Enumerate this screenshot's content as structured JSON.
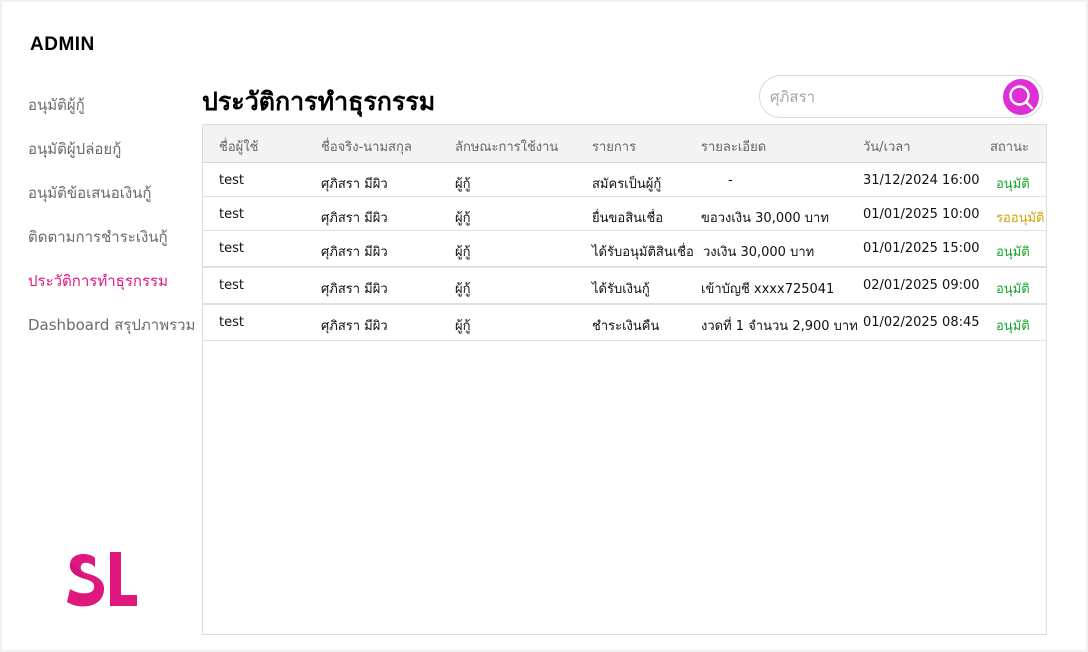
{
  "app": {
    "brand": "ADMIN"
  },
  "sidebar": {
    "items": [
      {
        "label": "อนุมัติผู้กู้",
        "active": false
      },
      {
        "label": "อนุมัติผู้ปล่อยกู้",
        "active": false
      },
      {
        "label": "อนุมัติข้อเสนอเงินกู้",
        "active": false
      },
      {
        "label": "ติดตามการชำระเงินกู้",
        "active": false
      },
      {
        "label": "ประวัติการทำธุรกรรม",
        "active": true
      },
      {
        "label": "Dashboard สรุปภาพรวม",
        "active": false
      }
    ]
  },
  "logo": {
    "text": "SL",
    "color": "#e0187e"
  },
  "page": {
    "title": "ประวัติการทำธุรกรรม"
  },
  "search": {
    "value": "",
    "placeholder": "ศุภิสรา",
    "icon": "search-icon",
    "button_color": "#dd2fd5"
  },
  "table": {
    "columns": [
      "ชื่อผู้ใช้",
      "ชื่อจริง-นามสกุล",
      "ลักษณะการใช้งาน",
      "รายการ",
      "รายละเอียด",
      "วัน/เวลา",
      "สถานะ"
    ],
    "rows": [
      [
        "test",
        "ศุภิสรา มีผิว",
        "ผู้กู้",
        "สมัครเป็นผู้กู้",
        "-",
        "31/12/2024 16:00",
        "อนุมัติ"
      ],
      [
        "test",
        "ศุภิสรา มีผิว",
        "ผู้กู้",
        "ยื่นขอสินเชื่อ",
        "ขอวงเงิน 30,000 บาท",
        "01/01/2025 10:00",
        "รออนุมัติ"
      ],
      [
        "test",
        "ศุภิสรา มีผิว",
        "ผู้กู้",
        "ได้รับอนุมัติสินเชื่อ",
        "วงเงิน 30,000 บาท",
        "01/01/2025 15:00",
        "อนุมัติ"
      ],
      [
        "test",
        "ศุภิสรา มีผิว",
        "ผู้กู้",
        "ได้รับเงินกู้",
        "เข้าบัญชี xxxx725041",
        "02/01/2025 09:00",
        "อนุมัติ"
      ],
      [
        "test",
        "ศุภิสรา มีผิว",
        "ผู้กู้",
        "ชำระเงินคืน",
        "งวดที่ 1 จำนวน 2,900 บาท",
        "01/02/2025 08:45",
        "อนุมัติ"
      ]
    ],
    "status_colors": {
      "อนุมัติ": "#16a52c",
      "รออนุมัติ": "#d2a300"
    }
  }
}
